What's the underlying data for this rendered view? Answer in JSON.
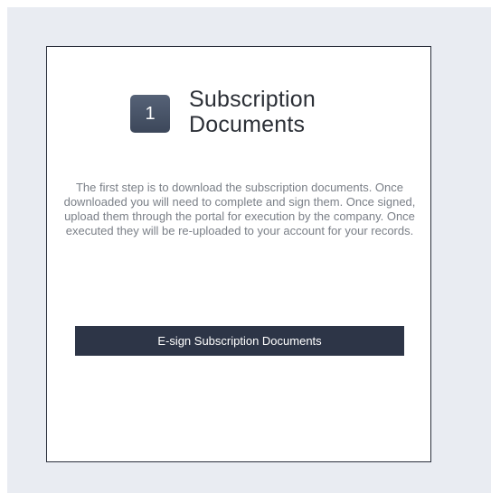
{
  "step": {
    "number": "1",
    "title": "Subscription Documents",
    "description": "The first step is to download the subscription documents. Once downloaded you will need to complete and sign them. Once signed, upload them through the portal for execution by the company. Once executed they will be re-uploaded to your account for your records."
  },
  "actions": {
    "esign_label": "E-sign Subscription Documents"
  },
  "colors": {
    "background": "#e9ecf2",
    "card": "#ffffff",
    "button": "#2d3547",
    "badge": "#4a5568"
  }
}
